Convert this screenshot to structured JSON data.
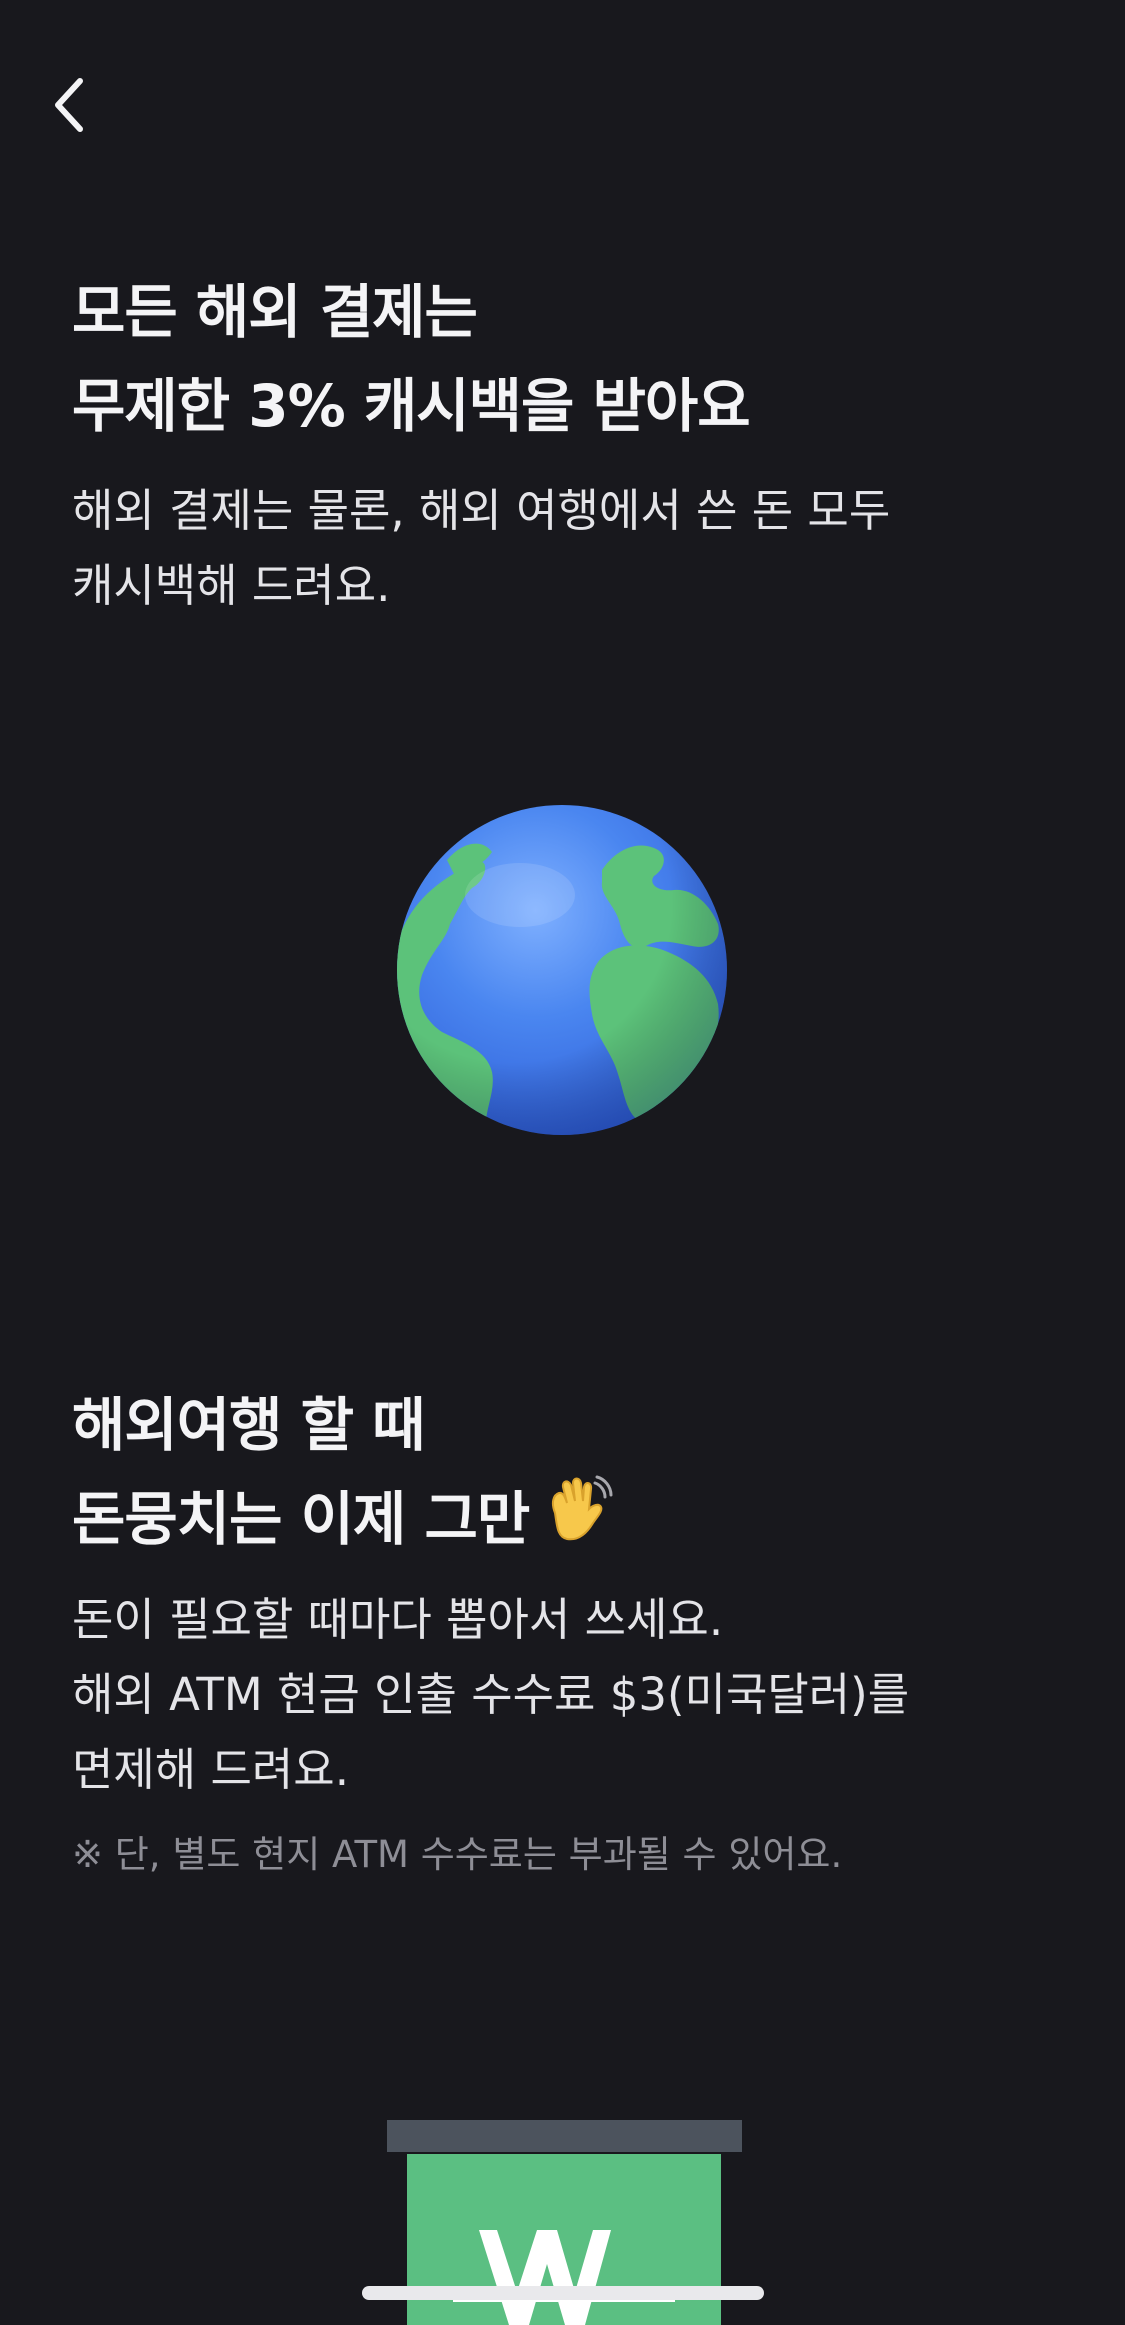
{
  "nav": {
    "back_icon": "chevron-left-icon"
  },
  "section1": {
    "title_lines": [
      "모든 해외 결제는",
      "무제한 3% 캐시백을 받아요"
    ],
    "description_lines": [
      "해외 결제는 물론, 해외 여행에서 쓴 돈 모두",
      "캐시백해 드려요."
    ],
    "illustration_icon": "globe-icon"
  },
  "section2": {
    "title_lines": [
      "해외여행 할 때",
      "돈뭉치는 이제 그만"
    ],
    "title_emoji_icon": "waving-hand-icon",
    "description_lines": [
      "돈이 필요할 때마다 뽑아서 쓰세요.",
      "해외 ATM 현금 인출 수수료 $3(미국달러)를",
      "면제해 드려요."
    ],
    "note": "※ 단, 별도 현지 ATM 수수료는 부과될 수 있어요.",
    "illustration_icon": "atm-won-icon"
  },
  "colors": {
    "background": "#18181d",
    "text": "#f4f4f6",
    "muted_text": "#8e8e96",
    "atm_green": "#5bbf82",
    "atm_gray": "#4c535d"
  }
}
